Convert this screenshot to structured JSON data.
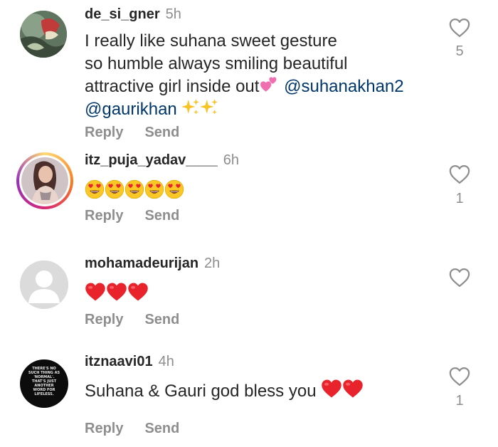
{
  "colors": {
    "text": "#262626",
    "secondary": "#8e8e8e",
    "mention": "#00376b",
    "story_ring": [
      "#feda75",
      "#fa7e1e",
      "#d62976",
      "#962fbf"
    ],
    "heart_emoji": "#e8232c"
  },
  "icons": {
    "like": "heart-outline-icon",
    "heart_emoji": "red-heart-emoji",
    "smile_emoji": "heart-eyes-emoji",
    "sparkles_emoji": "sparkles-emoji",
    "pink_hearts_emoji": "two-hearts-emoji"
  },
  "comments": [
    {
      "username": "de_si_gner",
      "time": "5h",
      "text_lines": [
        "I really like suhana sweet gesture",
        "so humble always smiling beautiful",
        "attractive girl inside out"
      ],
      "mentions": [
        "@suhanakhan2",
        "@gaurikhan"
      ],
      "reply_label": "Reply",
      "send_label": "Send",
      "like_count": "5"
    },
    {
      "username": "itz_puja_yadav____",
      "time": "6h",
      "reply_label": "Reply",
      "send_label": "Send",
      "like_count": "1"
    },
    {
      "username": "mohamadeurijan",
      "time": "2h",
      "reply_label": "Reply",
      "send_label": "Send"
    },
    {
      "username": "itznaavi01",
      "time": "4h",
      "text": "Suhana & Gauri god bless you",
      "reply_label": "Reply",
      "send_label": "Send",
      "like_count": "1"
    }
  ],
  "avatar_text": [
    "THERE'S NO",
    "SUCH THING AS",
    "'NORMAL'.",
    "THAT'S JUST",
    "ANOTHER",
    "WORD FOR",
    "LIFELESS."
  ]
}
